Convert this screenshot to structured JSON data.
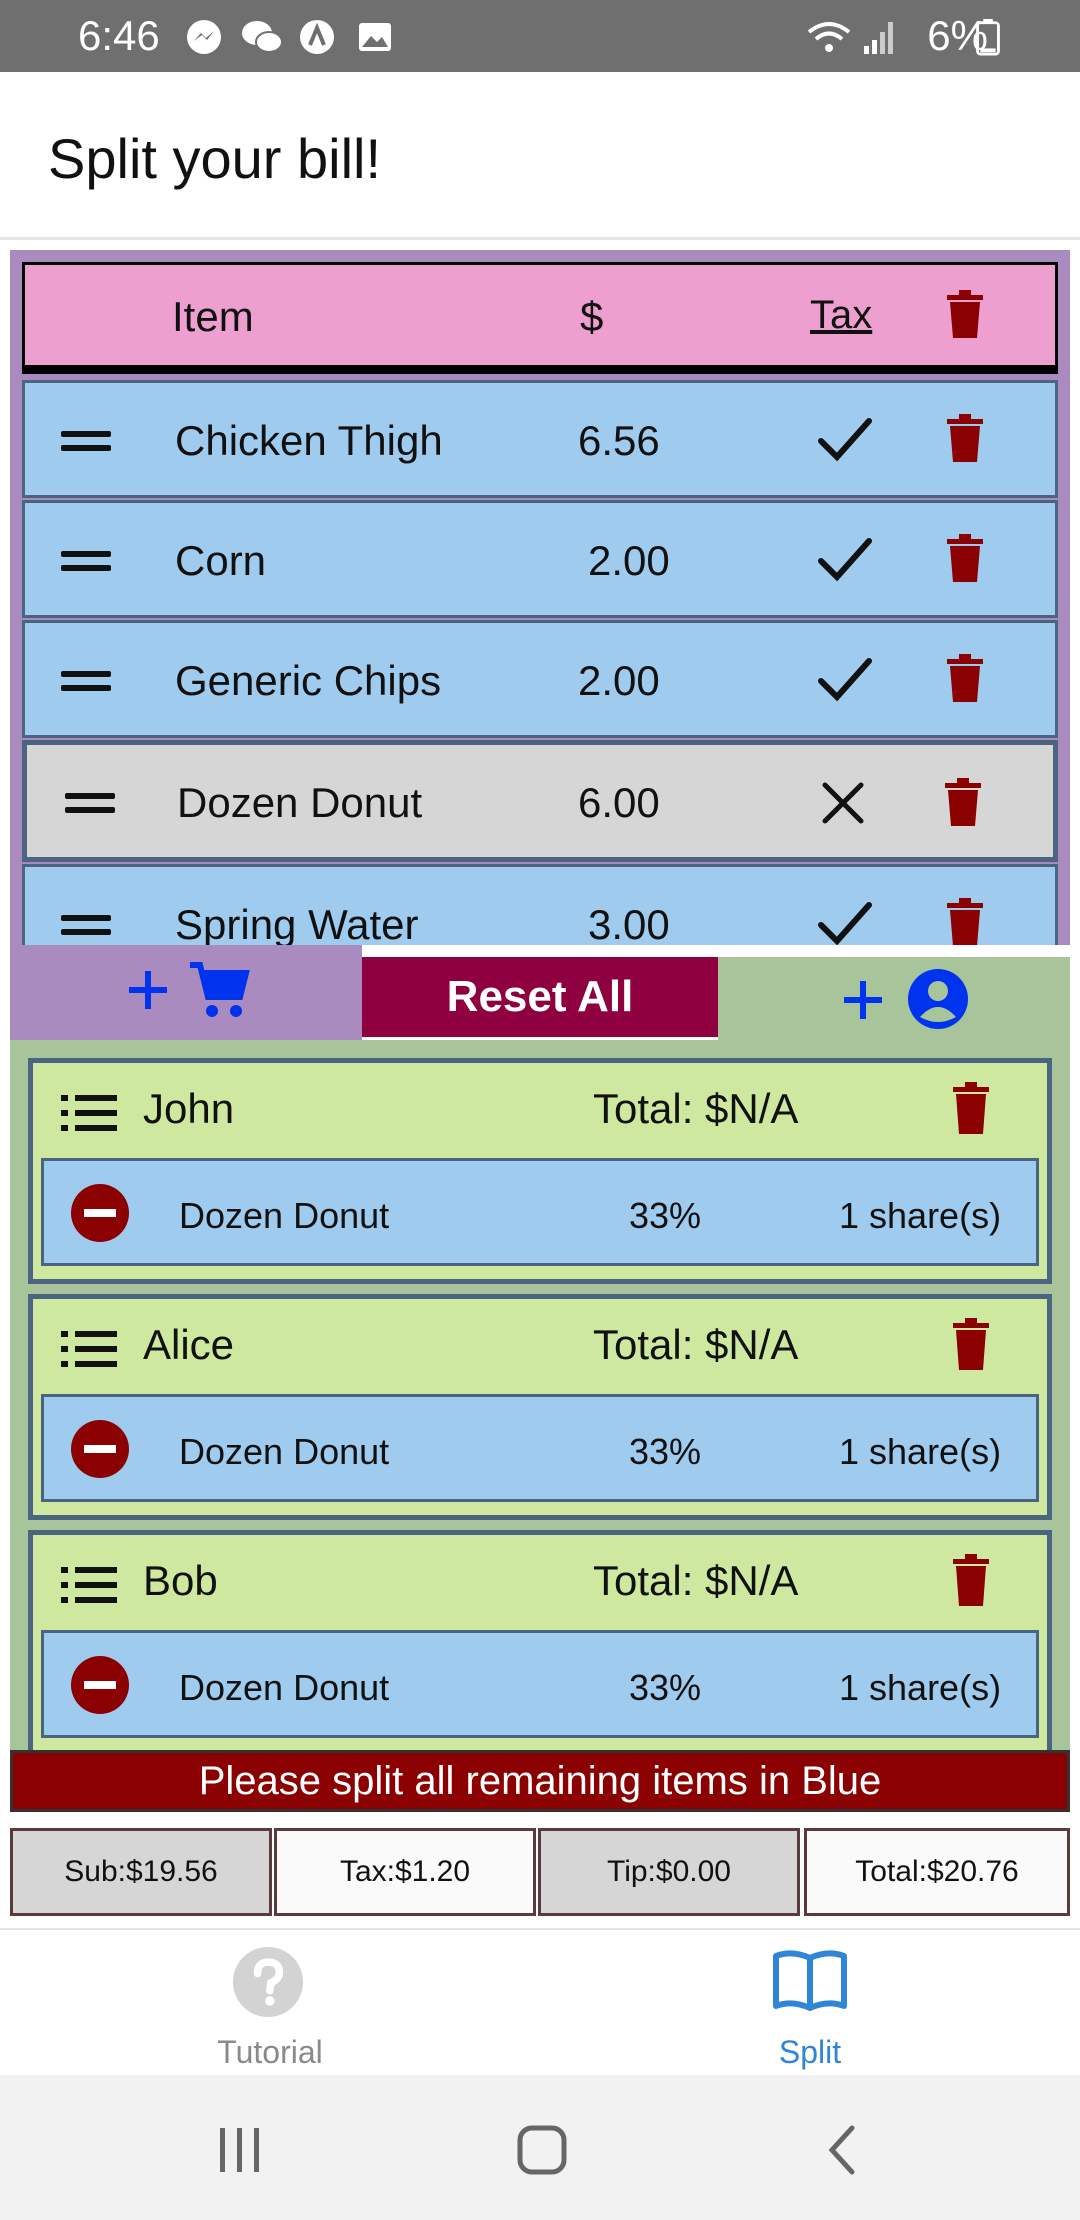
{
  "status_bar": {
    "time": "6:46",
    "battery_text": "6%",
    "left_icons": [
      "messenger-icon",
      "wechat-icon",
      "app-icon",
      "image-icon"
    ],
    "right_icons": [
      "wifi-icon",
      "signal-icon",
      "battery-icon"
    ]
  },
  "app_bar": {
    "title": "Split your bill!"
  },
  "items_table": {
    "headers": {
      "item": "Item",
      "price": "$",
      "tax": "Tax"
    },
    "rows": [
      {
        "name": "Chicken Thigh",
        "price": "6.56",
        "taxed": true
      },
      {
        "name": "Corn",
        "price": "2.00",
        "taxed": true
      },
      {
        "name": "Generic Chips",
        "price": "2.00",
        "taxed": true
      },
      {
        "name": "Dozen Donut",
        "price": "6.00",
        "taxed": false
      },
      {
        "name": "Spring Water",
        "price": "3.00",
        "taxed": true
      }
    ]
  },
  "actions": {
    "add_item_icon": "add-to-cart-icon",
    "reset_label": "Reset All",
    "add_person_icon": "add-person-icon"
  },
  "people": [
    {
      "name": "John",
      "total": "Total: $N/A",
      "share": {
        "item": "Dozen Donut",
        "percent": "33%",
        "shares": "1 share(s)"
      }
    },
    {
      "name": "Alice",
      "total": "Total: $N/A",
      "share": {
        "item": "Dozen Donut",
        "percent": "33%",
        "shares": "1 share(s)"
      }
    },
    {
      "name": "Bob",
      "total": "Total: $N/A",
      "share": {
        "item": "Dozen Donut",
        "percent": "33%",
        "shares": "1 share(s)"
      }
    }
  ],
  "warning": "Please split all remaining items in Blue",
  "totals": {
    "sub": "Sub:$19.56",
    "tax": "Tax:$1.20",
    "tip": "Tip:$0.00",
    "total": "Total:$20.76"
  },
  "tabs": [
    {
      "label": "Tutorial",
      "icon": "help-circle-icon",
      "active": false
    },
    {
      "label": "Split",
      "icon": "book-open-icon",
      "active": true
    }
  ],
  "colors": {
    "item_row": "#9fcbee",
    "item_excluded": "#d6d6d6",
    "header_pink": "#eda0cf",
    "panel_purple": "#a98bbf",
    "person_green": "#cfe89f",
    "reset_button": "#8e0040",
    "warning_red": "#8b0000",
    "trash_red": "#8b0000",
    "accent_blue": "#0033ee",
    "tab_active": "#2f86d6",
    "tab_inactive": "#8a8a8a"
  }
}
